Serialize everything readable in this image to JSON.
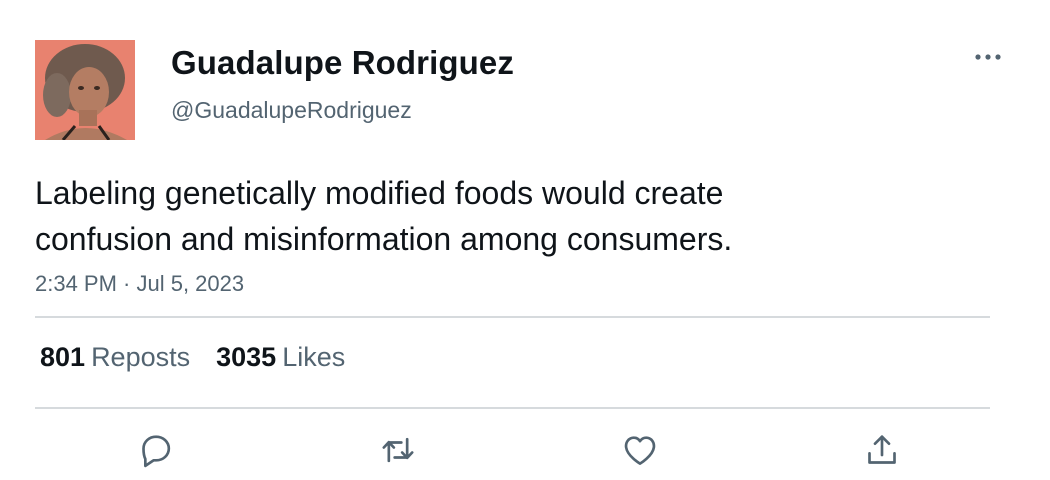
{
  "tweet": {
    "author_name": "Guadalupe Rodriguez",
    "author_handle": "@GuadalupeRodriguez",
    "text_line1": "Labeling genetically modified foods would create",
    "text_line2": "confusion and misinformation among consumers.",
    "timestamp": "2:34 PM · Jul 5, 2023"
  },
  "stats": {
    "reposts_count": "801",
    "reposts_label": "Reposts",
    "likes_count": "3035",
    "likes_label": "Likes"
  },
  "icons": {
    "more": "more-horizontal-icon",
    "reply": "reply-icon",
    "repost": "repost-icon",
    "like": "like-icon",
    "share": "share-icon"
  },
  "colors": {
    "text": "#0f1419",
    "secondary": "#536471",
    "divider": "#d6dadd",
    "avatar_bg": "#e8826f"
  }
}
